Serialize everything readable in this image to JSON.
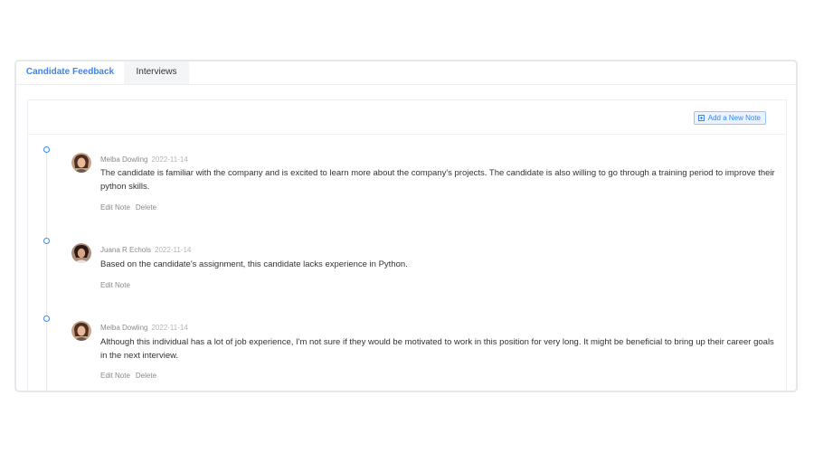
{
  "tabs": [
    {
      "label": "Candidate Feedback",
      "active": true
    },
    {
      "label": "Interviews",
      "active": false
    }
  ],
  "add_note_label": "Add a New Note",
  "notes": [
    {
      "author": "Melba Dowling",
      "date": "2022-11-14",
      "text": "The candidate is familiar with the company and is excited to learn more about the company's projects. The candidate is also willing to go through a training period to improve their python skills.",
      "edit_label": "Edit Note",
      "delete_label": "Delete"
    },
    {
      "author": "Juana R Echols",
      "date": "2022-11-14",
      "text": "Based on the candidate's assignment, this candidate lacks experience in Python.",
      "edit_label": "Edit Note"
    },
    {
      "author": "Melba Dowling",
      "date": "2022-11-14",
      "text": "Although this individual has a lot of job experience, I'm not sure if they would be motivated to work in this position for very long. It might be beneficial to bring up their career goals in the next interview.",
      "edit_label": "Edit Note",
      "delete_label": "Delete"
    }
  ],
  "colors": {
    "accent": "#3a86f0",
    "border": "#e6e7ea"
  }
}
